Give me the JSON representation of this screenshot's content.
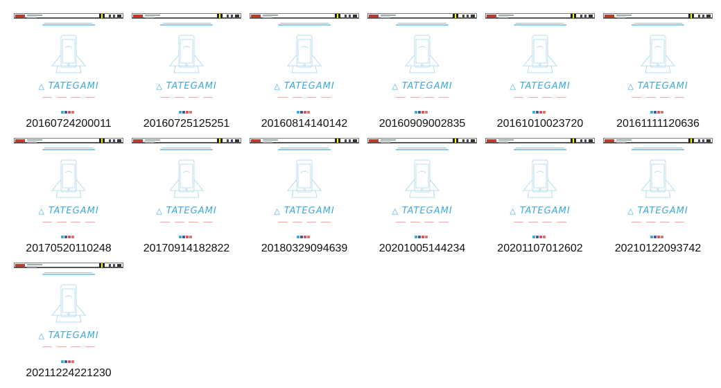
{
  "thumbnails": [
    {
      "label": "20160724200011"
    },
    {
      "label": "20160725125251"
    },
    {
      "label": "20160814140142"
    },
    {
      "label": "20160909002835"
    },
    {
      "label": "20161010023720"
    },
    {
      "label": "20161111120636"
    },
    {
      "label": "20170520110248"
    },
    {
      "label": "20170914182822"
    },
    {
      "label": "20180329094639"
    },
    {
      "label": "20201005144234"
    },
    {
      "label": "20201107012602"
    },
    {
      "label": "20210122093742"
    },
    {
      "label": "20211224221230"
    }
  ],
  "logo_text": "TATEGAMI",
  "colors": {
    "logo": "#3aa9e0",
    "phone_outline": "#b8dcee",
    "menu": "#e88888",
    "social": [
      "#3aa9e0",
      "#3b5998",
      "#e05050",
      "#e07070"
    ]
  }
}
